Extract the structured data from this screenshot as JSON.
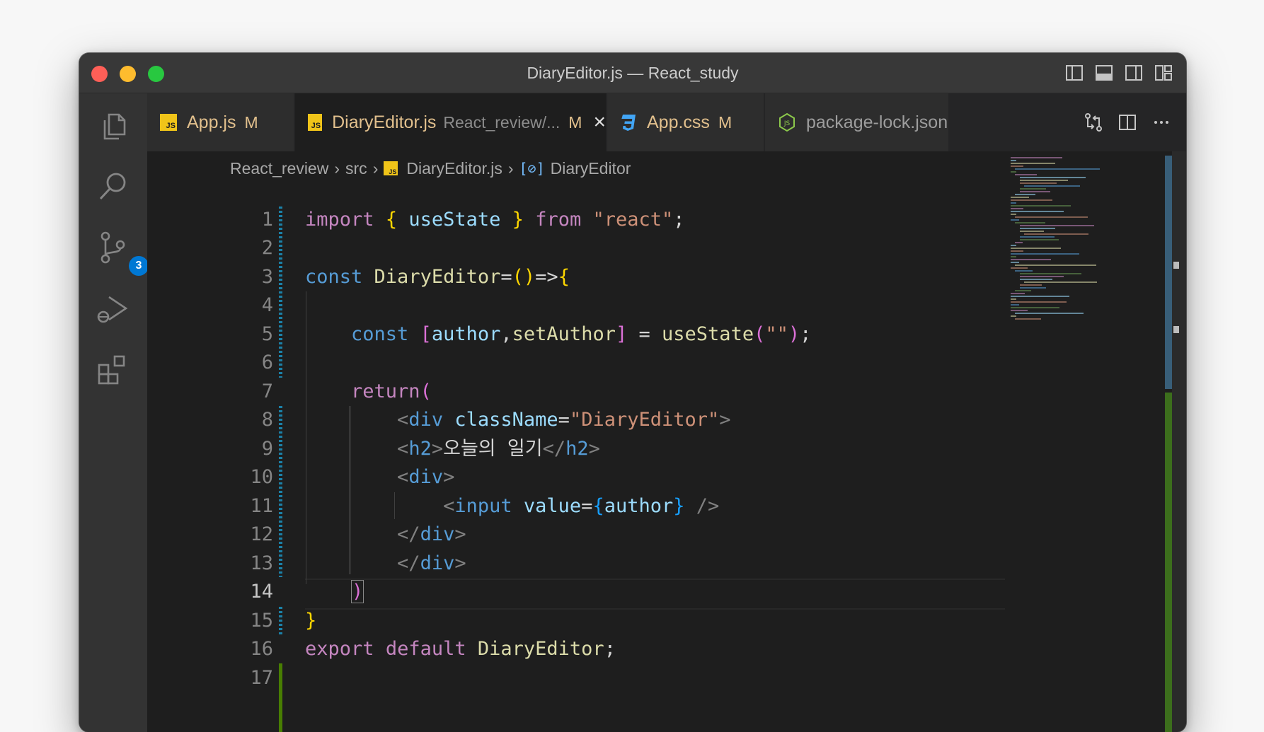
{
  "window": {
    "title": "DiaryEditor.js — React_study",
    "layout_controls": [
      "toggle-primary-sidebar-icon",
      "toggle-panel-icon",
      "toggle-secondary-sidebar-icon",
      "customize-layout-icon"
    ]
  },
  "activity_bar": {
    "items": [
      "explorer-icon",
      "search-icon",
      "source-control-icon",
      "run-debug-icon",
      "extensions-icon"
    ],
    "source_control_badge": "3"
  },
  "tabs": [
    {
      "icon": "JS",
      "label": "App.js",
      "flag": "M",
      "active": false
    },
    {
      "icon": "JS",
      "label": "DiaryEditor.js",
      "description": "React_review/...",
      "flag": "M",
      "close": "×",
      "active": true
    },
    {
      "icon": "css-icon",
      "label": "App.css",
      "flag": "M",
      "active": false
    },
    {
      "icon": "nodejs-icon",
      "label": "package-lock.json",
      "active": false
    }
  ],
  "tab_actions": [
    "open-changes-icon",
    "split-editor-icon",
    "more-actions-icon"
  ],
  "breadcrumb": {
    "parts": [
      "React_review",
      "src",
      "DiaryEditor.js",
      "DiaryEditor"
    ],
    "file_icon": "JS"
  },
  "editor": {
    "current_line": 14,
    "line_numbers": [
      "1",
      "2",
      "3",
      "4",
      "5",
      "6",
      "7",
      "8",
      "9",
      "10",
      "11",
      "12",
      "13",
      "14",
      "15",
      "16",
      "17"
    ],
    "lines": [
      "import { useState } from \"react\";",
      "",
      "const DiaryEditor=()=>{",
      "",
      "    const [author,setAuthor] = useState(\"\");",
      "",
      "    return(",
      "        <div className=\"DiaryEditor\">",
      "        <h2>오늘의 일기</h2>",
      "        <div>",
      "            <input value={author} />",
      "        </div>",
      "        </div>",
      "    )",
      "}",
      "export default DiaryEditor;",
      ""
    ]
  },
  "colors": {
    "keyword": "#c586c0",
    "storage": "#569cd6",
    "function": "#dcdcaa",
    "variable": "#9cdcfe",
    "string": "#ce9178",
    "bracket_gold": "#ffd700",
    "bracket_orchid": "#da70d6",
    "bracket_blue": "#179fff",
    "git_modified": "#1b81a8",
    "git_added": "#487e02"
  }
}
